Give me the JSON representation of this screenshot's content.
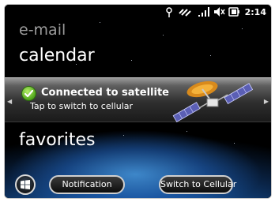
{
  "status_bar": {
    "icons": [
      "antenna-icon",
      "satellite-icon",
      "signal-bars-icon",
      "speaker-muted-icon",
      "battery-icon"
    ],
    "time": "2:14"
  },
  "menu": {
    "email": "e-mail",
    "calendar": "calendar",
    "favorites": "favorites"
  },
  "satellite_panel": {
    "title": "Connected to satellite",
    "subtitle": "Tap to switch to cellular"
  },
  "soft_keys": {
    "start_icon": "windows-logo-icon",
    "left": "Notification",
    "right": "Switch to Cellular"
  },
  "colors": {
    "check_green": "#4fa51a",
    "earth_blue": "#2c6fb7"
  }
}
